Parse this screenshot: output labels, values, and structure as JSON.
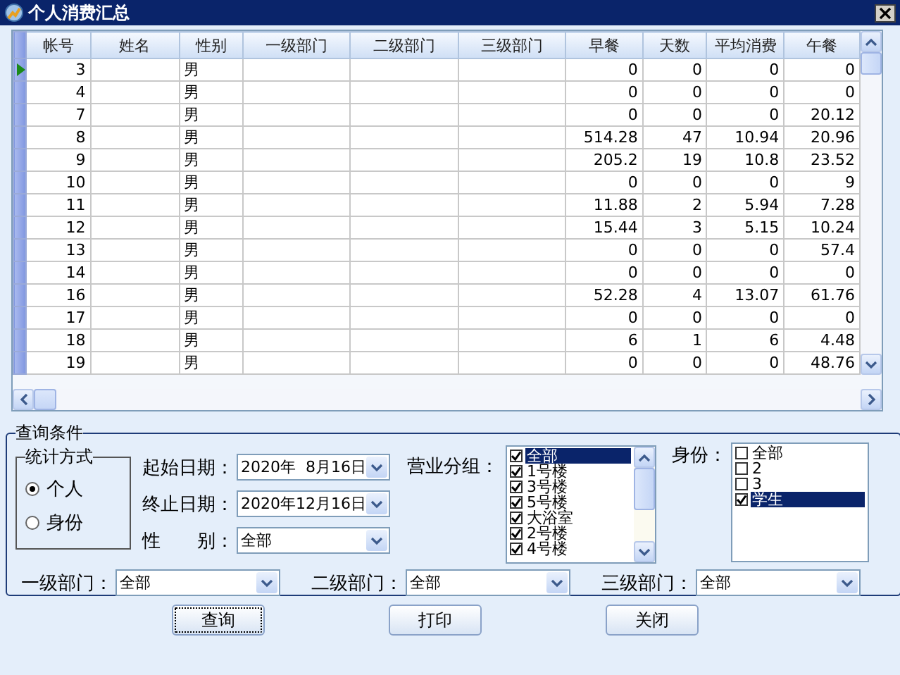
{
  "window": {
    "title": "个人消费汇总"
  },
  "table": {
    "columns": [
      "帐号",
      "姓名",
      "性别",
      "一级部门",
      "二级部门",
      "三级部门",
      "早餐",
      "天数",
      "平均消费",
      "午餐"
    ],
    "rows": [
      {
        "selected": true,
        "cells": [
          "3",
          "",
          "男",
          "",
          "",
          "",
          "0",
          "0",
          "0",
          "0"
        ]
      },
      {
        "selected": false,
        "cells": [
          "4",
          "",
          "男",
          "",
          "",
          "",
          "0",
          "0",
          "0",
          "0"
        ]
      },
      {
        "selected": false,
        "cells": [
          "7",
          "",
          "男",
          "",
          "",
          "",
          "0",
          "0",
          "0",
          "20.12"
        ]
      },
      {
        "selected": false,
        "cells": [
          "8",
          "",
          "男",
          "",
          "",
          "",
          "514.28",
          "47",
          "10.94",
          "20.96"
        ]
      },
      {
        "selected": false,
        "cells": [
          "9",
          "",
          "男",
          "",
          "",
          "",
          "205.2",
          "19",
          "10.8",
          "23.52"
        ]
      },
      {
        "selected": false,
        "cells": [
          "10",
          "",
          "男",
          "",
          "",
          "",
          "0",
          "0",
          "0",
          "9"
        ]
      },
      {
        "selected": false,
        "cells": [
          "11",
          "",
          "男",
          "",
          "",
          "",
          "11.88",
          "2",
          "5.94",
          "7.28"
        ]
      },
      {
        "selected": false,
        "cells": [
          "12",
          "",
          "男",
          "",
          "",
          "",
          "15.44",
          "3",
          "5.15",
          "10.24"
        ]
      },
      {
        "selected": false,
        "cells": [
          "13",
          "",
          "男",
          "",
          "",
          "",
          "0",
          "0",
          "0",
          "57.4"
        ]
      },
      {
        "selected": false,
        "cells": [
          "14",
          "",
          "男",
          "",
          "",
          "",
          "0",
          "0",
          "0",
          "0"
        ]
      },
      {
        "selected": false,
        "cells": [
          "16",
          "",
          "男",
          "",
          "",
          "",
          "52.28",
          "4",
          "13.07",
          "61.76"
        ]
      },
      {
        "selected": false,
        "cells": [
          "17",
          "",
          "男",
          "",
          "",
          "",
          "0",
          "0",
          "0",
          "0"
        ]
      },
      {
        "selected": false,
        "cells": [
          "18",
          "",
          "男",
          "",
          "",
          "",
          "6",
          "1",
          "6",
          "4.48"
        ]
      },
      {
        "selected": false,
        "cells": [
          "19",
          "",
          "男",
          "",
          "",
          "",
          "0",
          "0",
          "0",
          "48.76"
        ]
      }
    ]
  },
  "query": {
    "title": "查询条件",
    "stat_mode": {
      "title": "统计方式",
      "options": [
        {
          "label": "个人",
          "selected": true
        },
        {
          "label": "身份",
          "selected": false
        }
      ]
    },
    "start_date": {
      "label": "起始日期：",
      "value": "2020年  8月16日"
    },
    "end_date": {
      "label": "终止日期：",
      "value": "2020年12月16日"
    },
    "gender": {
      "label": "性　　别：",
      "value": "全部"
    },
    "business_group": {
      "label": "营业分组：",
      "items": [
        {
          "label": "全部",
          "checked": true,
          "selected": true
        },
        {
          "label": "1号楼",
          "checked": true,
          "selected": false
        },
        {
          "label": "3号楼",
          "checked": true,
          "selected": false
        },
        {
          "label": "5号楼",
          "checked": true,
          "selected": false
        },
        {
          "label": "大浴室",
          "checked": true,
          "selected": false
        },
        {
          "label": "2号楼",
          "checked": true,
          "selected": false
        },
        {
          "label": "4号楼",
          "checked": true,
          "selected": false
        }
      ]
    },
    "identity": {
      "label": "身份：",
      "items": [
        {
          "label": "全部",
          "checked": false,
          "selected": false
        },
        {
          "label": "2",
          "checked": false,
          "selected": false
        },
        {
          "label": "3",
          "checked": false,
          "selected": false
        },
        {
          "label": "学生",
          "checked": true,
          "selected": true
        }
      ]
    },
    "departments": [
      {
        "label": "一级部门：",
        "value": "全部"
      },
      {
        "label": "二级部门：",
        "value": "全部"
      },
      {
        "label": "三级部门：",
        "value": "全部"
      }
    ]
  },
  "buttons": [
    {
      "label": "查询",
      "focused": true
    },
    {
      "label": "打印",
      "focused": false
    },
    {
      "label": "关闭",
      "focused": false
    }
  ]
}
